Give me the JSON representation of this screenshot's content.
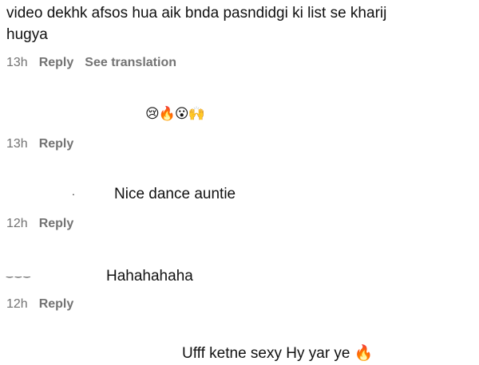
{
  "comments": [
    {
      "text_line1": "video dekhk afsos hua aik bnda pasndidgi ki list se kharij",
      "text_line2": "hugya",
      "time": "13h",
      "reply": "Reply",
      "translate": "See translation"
    },
    {
      "emojis": "😢🔥😮🙌",
      "time": "13h",
      "reply": "Reply"
    },
    {
      "text": "Nice dance auntie",
      "time": "12h",
      "reply": "Reply"
    },
    {
      "text": "Hahahahaha",
      "time": "12h",
      "reply": "Reply"
    },
    {
      "text": "Ufff ketne sexy Hy yar ye",
      "emoji": "🔥"
    }
  ]
}
